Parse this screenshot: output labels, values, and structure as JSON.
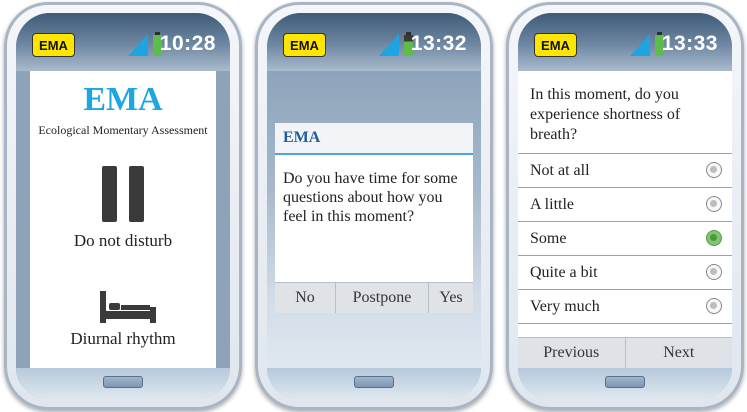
{
  "status": {
    "badge": "EMA"
  },
  "phone1": {
    "time": "10:28",
    "title": "EMA",
    "subtitle": "Ecological Momentary Assessment",
    "do_not_disturb": "Do not disturb",
    "diurnal_rhythm": "Diurnal rhythm",
    "icons": [
      "pause-icon",
      "bed-icon"
    ]
  },
  "phone2": {
    "time": "13:32",
    "dialog": {
      "title": "EMA",
      "question": "Do you have time for some questions about how you feel in this moment?",
      "buttons": [
        "No",
        "Postpone",
        "Yes"
      ]
    }
  },
  "phone3": {
    "time": "13:33",
    "question": "In this moment, do you experience shortness of breath?",
    "options": [
      "Not at all",
      "A little",
      "Some",
      "Quite a bit",
      "Very much"
    ],
    "selected": "Some",
    "previous": "Previous",
    "next": "Next"
  },
  "colors": {
    "accent": "#1aa7e4",
    "badge": "#ffe600",
    "battery": "#5ebd4a",
    "selected_radio": "#7fc66e"
  }
}
